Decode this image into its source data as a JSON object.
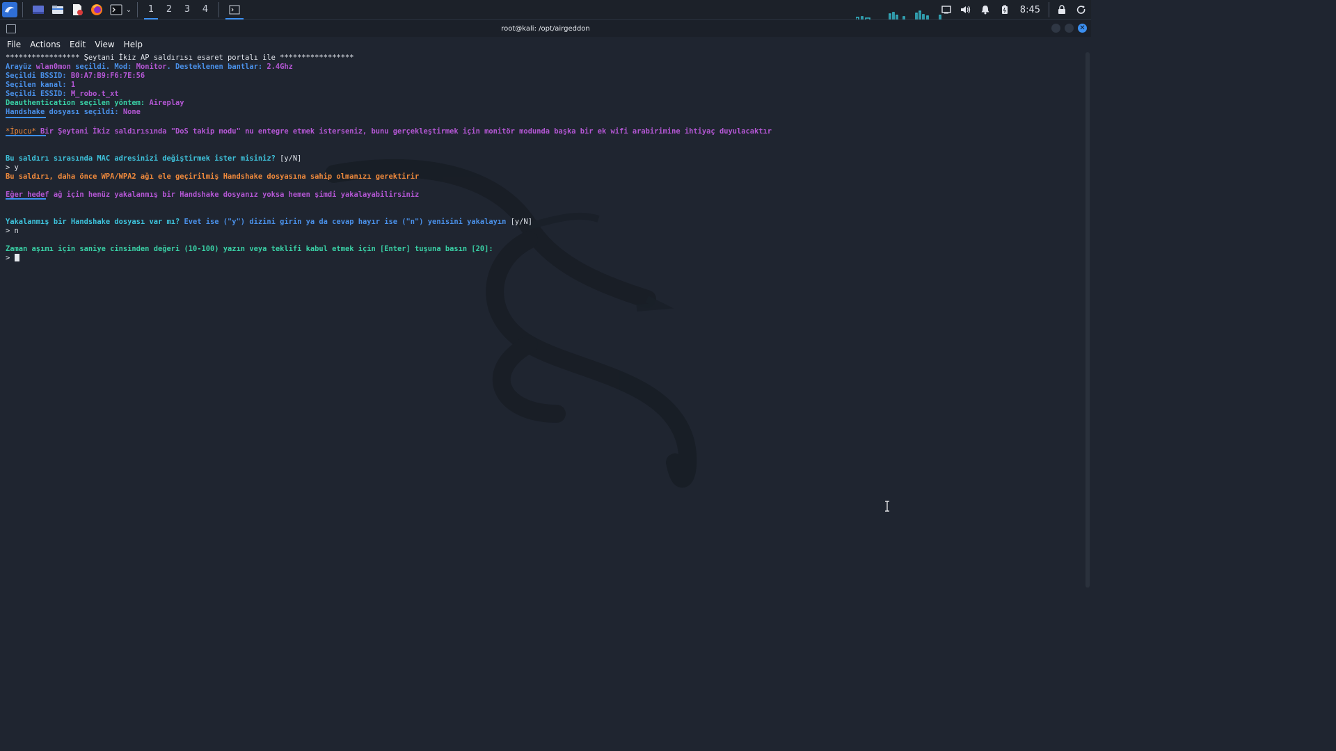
{
  "taskbar": {
    "launchers": [
      {
        "name": "kali-menu-icon",
        "glyph": "🐉"
      },
      {
        "name": "desktop-icon",
        "glyph": "▭"
      },
      {
        "name": "file-manager-icon",
        "glyph": "🗀"
      },
      {
        "name": "text-editor-icon",
        "glyph": "🗎"
      },
      {
        "name": "firefox-icon",
        "glyph": "🦊"
      },
      {
        "name": "terminal-icon",
        "glyph": "▣"
      }
    ],
    "workspaces": [
      "1",
      "2",
      "3",
      "4"
    ],
    "active_workspace": "1",
    "clock": "8:45",
    "tray": [
      "display-icon",
      "volume-icon",
      "bell-icon",
      "battery-icon",
      "lock-icon",
      "power-icon"
    ]
  },
  "window": {
    "title": "root@kali: /opt/airgeddon",
    "menu": [
      "File",
      "Actions",
      "Edit",
      "View",
      "Help"
    ]
  },
  "terminal": {
    "l01": {
      "stars_a": "*****************",
      "heading": " Şeytani İkiz AP saldırısı esaret portalı ile ",
      "stars_b": "*****************"
    },
    "l02": {
      "a": "Arayüz ",
      "b": "wlan0mon",
      "c": " seçildi. Mod: ",
      "d": "Monitor",
      "e": ". Desteklenen bantlar: ",
      "f": "2.4Ghz"
    },
    "l03": {
      "a": "Seçildi BSSID: ",
      "b": "B0:A7:B9:F6:7E:56"
    },
    "l04": {
      "a": "Seçilen kanal: ",
      "b": "1"
    },
    "l05": {
      "a": "Seçildi ESSID: ",
      "b": "M_robo.t_xt"
    },
    "l06": {
      "a": "Deauthentication seçilen yöntem: ",
      "b": "Aireplay"
    },
    "l07": {
      "a": "Handshake dosyası seçildi: ",
      "b": "None"
    },
    "l08": {
      "a": "*İpucu*",
      "b": " Bir Şeytani İkiz saldırısında \"DoS takip modu\" nu entegre etmek isterseniz, bunu gerçekleştirmek için monitör modunda başka bir ek wifi arabirimine ihtiyaç duyulacaktır"
    },
    "l09": {
      "a": "Bu saldırı sırasında MAC adresinizi değiştirmek ister misiniz? ",
      "b": "[y/N]"
    },
    "l10": "> y",
    "l11": "Bu saldırı, daha önce WPA/WPA2 ağı ele geçirilmiş Handshake dosyasına sahip olmanızı gerektirir",
    "l12": "Eğer hedef ağ için henüz yakalanmış bir Handshake dosyanız yoksa hemen şimdi yakalayabilirsiniz",
    "l13": {
      "a": "Yakalanmış bir Handshake dosyası var mı? ",
      "b": "Evet ise (\"y\") dizini girin ya da cevap hayır ise (\"n\") yenisini yakalayın ",
      "c": "[y/N]"
    },
    "l14": "> n",
    "l15": "Zaman aşımı için saniye cinsinden değeri (10-100) yazın veya teklifi kabul etmek için [Enter] tuşuna basın [20]:",
    "l16": "> "
  },
  "colors": {
    "cyan": "#3ec3dc",
    "purple": "#b457d4",
    "orange": "#f08a3c",
    "blue": "#4a90e8",
    "green": "#39d0a5",
    "accent": "#3b8ff0"
  }
}
